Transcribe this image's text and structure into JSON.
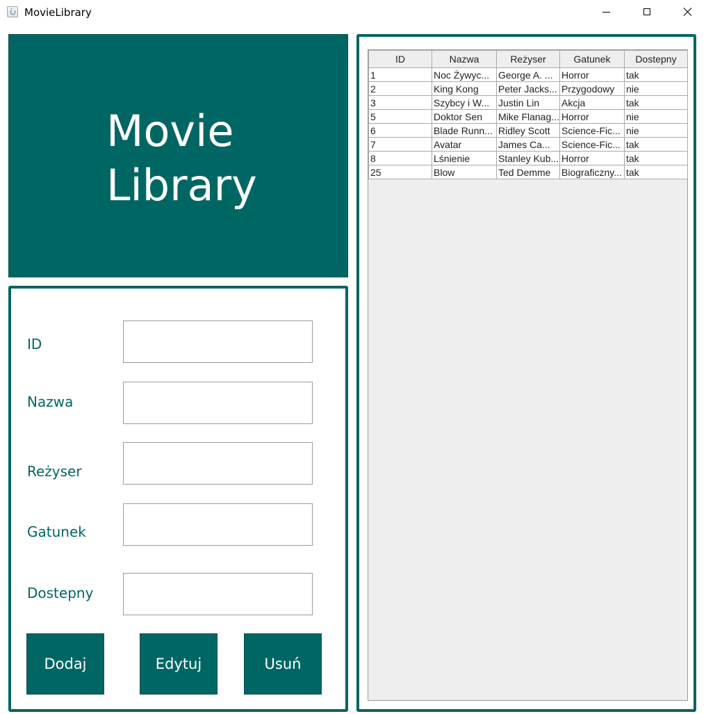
{
  "window": {
    "title": "MovieLibrary"
  },
  "banner": {
    "line1": "Movie",
    "line2": "Library"
  },
  "form": {
    "fields": [
      {
        "label": "ID",
        "value": "",
        "placeholder": ""
      },
      {
        "label": "Nazwa",
        "value": "",
        "placeholder": ""
      },
      {
        "label": "Reżyser",
        "value": "",
        "placeholder": ""
      },
      {
        "label": "Gatunek",
        "value": "",
        "placeholder": ""
      },
      {
        "label": "Dostepny",
        "value": "",
        "placeholder": ""
      }
    ],
    "buttons": {
      "add": "Dodaj",
      "edit": "Edytuj",
      "delete": "Usuń"
    }
  },
  "table": {
    "columns": [
      "ID",
      "Nazwa",
      "Reżyser",
      "Gatunek",
      "Dostepny"
    ],
    "rows": [
      [
        "1",
        "Noc Żywyc...",
        "George A. ...",
        "Horror",
        "tak"
      ],
      [
        "2",
        "King Kong",
        "Peter Jacks...",
        "Przygodowy",
        "nie"
      ],
      [
        "3",
        "Szybcy i W...",
        "Justin Lin",
        "Akcja",
        "tak"
      ],
      [
        "5",
        "Doktor Sen",
        "Mike Flanag...",
        "Horror",
        "nie"
      ],
      [
        "6",
        "Blade Runn...",
        "Ridley Scott",
        "Science-Fic...",
        "nie"
      ],
      [
        "7",
        "Avatar",
        "James Ca...",
        "Science-Fic...",
        "tak"
      ],
      [
        "8",
        "Lśnienie",
        "Stanley Kub...",
        "Horror",
        "tak"
      ],
      [
        "25",
        "Blow",
        "Ted Demme",
        "Biograficzny...",
        "tak"
      ]
    ]
  },
  "colors": {
    "accent": "#006664",
    "banner_text": "#ffffff"
  },
  "icons": {
    "app": "java-coffee-cup-icon",
    "minimize": "minimize-icon",
    "maximize": "maximize-icon",
    "close": "close-icon"
  }
}
